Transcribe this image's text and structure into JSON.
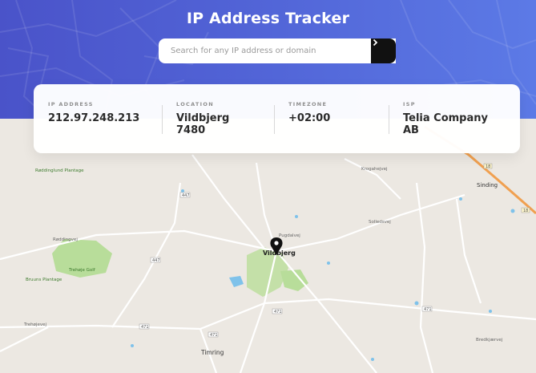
{
  "header": {
    "title": "IP Address Tracker",
    "search_placeholder": "Search for any IP address or domain",
    "search_value": "",
    "submit_icon": "chevron-right-icon"
  },
  "info": [
    {
      "key": "ip",
      "label": "IP ADDRESS",
      "value": "212.97.248.213"
    },
    {
      "key": "location",
      "label": "LOCATION",
      "value_lines": [
        "Vildbjerg",
        "7480"
      ]
    },
    {
      "key": "timezone",
      "label": "TIMEZONE",
      "value": "+02:00"
    },
    {
      "key": "isp",
      "label": "ISP",
      "value_lines": [
        "Telia Company",
        "AB"
      ]
    }
  ],
  "map": {
    "marker_icon": "map-pin-icon",
    "labels": {
      "vildbjerg": "Vildbjerg",
      "timring": "Timring",
      "sinding": "Sinding",
      "raddinglund": "Rødding­lund Plantage",
      "bruuns": "Bruuns Plantage",
      "trehoje_golf": "Trehøje Golf",
      "raddingvej": "Røddingvej",
      "trehojevej": "Trehøjevej",
      "krogahejvej": "Krogahejvej",
      "solledsvej": "Solledsvej",
      "bredkjaervej": "Bredkjærvej",
      "pugdalvej": "Pugdalvej"
    },
    "road_numbers": [
      "447",
      "447",
      "471",
      "471",
      "471",
      "471",
      "18",
      "18"
    ],
    "colors": {
      "land": "#ece8e2",
      "forest": "#b8dd9a",
      "water": "#7fc2ea",
      "highway": "#f0a050",
      "road": "#ffffff"
    }
  }
}
